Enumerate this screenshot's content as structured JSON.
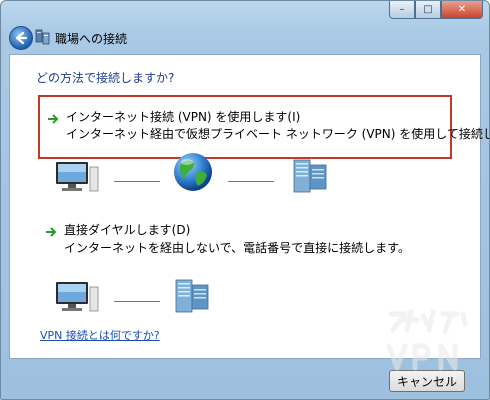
{
  "window": {
    "title": "職場への接続",
    "caption": {
      "minimize": "–",
      "maximize": "□",
      "close": "✕"
    }
  },
  "content": {
    "heading": "どの方法で接続しますか?",
    "options": [
      {
        "title": "インターネット接続 (VPN) を使用します(I)",
        "description": "インターネット経由で仮想プライベート ネットワーク (VPN) を使用して接続します。",
        "selected": true,
        "icons": [
          "computer-icon",
          "globe-icon",
          "server-icon"
        ]
      },
      {
        "title": "直接ダイヤルします(D)",
        "description": "インターネットを経由しないで、電話番号で直接に接続します。",
        "selected": false,
        "icons": [
          "computer-icon",
          "server-icon"
        ]
      }
    ],
    "help_link": "VPN 接続とは何ですか?"
  },
  "footer": {
    "cancel_label": "キャンセル"
  },
  "watermark": {
    "text": "スイッチ VPN"
  },
  "colors": {
    "selection_border": "#c23a26",
    "link": "#1a4fb3",
    "heading": "#1e3d8f"
  }
}
